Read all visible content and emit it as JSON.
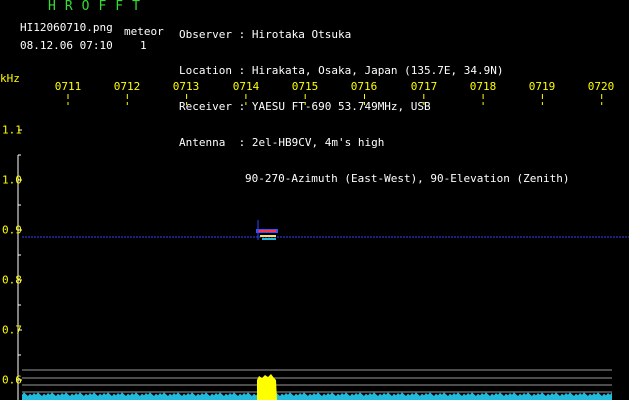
{
  "header": {
    "title": "HROFFT",
    "filename": "HI12060710.png",
    "datetime": "08.12.06 07:10",
    "meteor_label": "meteor",
    "meteor_count": "1"
  },
  "station": {
    "rows": [
      {
        "key": "Observer",
        "value": "Hirotaka Otsuka"
      },
      {
        "key": "Location",
        "value": "Hirakata, Osaka, Japan (135.7E, 34.9N)"
      },
      {
        "key": "Receiver",
        "value": "YAESU FT-690 53.749MHz, USB"
      },
      {
        "key": "Antenna ",
        "value": "2el-HB9CV, 4m's high"
      },
      {
        "key": "",
        "value": "90-270-Azimuth (East-West), 90-Elevation (Zenith)"
      }
    ]
  },
  "axes": {
    "freq_unit": "kHz",
    "time_ticks": [
      "0711",
      "0712",
      "0713",
      "0714",
      "0715",
      "0716",
      "0717",
      "0718",
      "0719",
      "0720"
    ],
    "freq_ticks": [
      "1.1",
      "1.0",
      "0.9",
      "0.8",
      "0.7",
      "0.6"
    ]
  },
  "colors": {
    "background": "#000000",
    "text_green": "#33dd33",
    "axis_yellow": "#ffff00",
    "carrier_blue": "#3344ff",
    "noise_cyan": "#22bbdd",
    "burst_yellow": "#ffff00"
  }
}
